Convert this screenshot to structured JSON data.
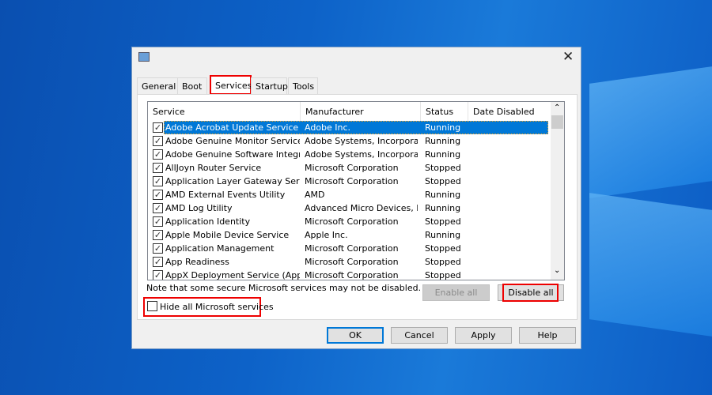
{
  "tabs": [
    "General",
    "Boot",
    "Services",
    "Startup",
    "Tools"
  ],
  "active_tab": "Services",
  "columns": [
    "Service",
    "Manufacturer",
    "Status",
    "Date Disabled"
  ],
  "rows": [
    {
      "service": "Adobe Acrobat Update Service",
      "manufacturer": "Adobe Inc.",
      "status": "Running",
      "checked": true,
      "selected": true
    },
    {
      "service": "Adobe Genuine Monitor Service",
      "manufacturer": "Adobe Systems, Incorpora...",
      "status": "Running",
      "checked": true
    },
    {
      "service": "Adobe Genuine Software Integri...",
      "manufacturer": "Adobe Systems, Incorpora...",
      "status": "Running",
      "checked": true
    },
    {
      "service": "AllJoyn Router Service",
      "manufacturer": "Microsoft Corporation",
      "status": "Stopped",
      "checked": true
    },
    {
      "service": "Application Layer Gateway Service",
      "manufacturer": "Microsoft Corporation",
      "status": "Stopped",
      "checked": true
    },
    {
      "service": "AMD External Events Utility",
      "manufacturer": "AMD",
      "status": "Running",
      "checked": true
    },
    {
      "service": "AMD Log Utility",
      "manufacturer": "Advanced Micro Devices, I...",
      "status": "Running",
      "checked": true
    },
    {
      "service": "Application Identity",
      "manufacturer": "Microsoft Corporation",
      "status": "Stopped",
      "checked": true
    },
    {
      "service": "Apple Mobile Device Service",
      "manufacturer": "Apple Inc.",
      "status": "Running",
      "checked": true
    },
    {
      "service": "Application Management",
      "manufacturer": "Microsoft Corporation",
      "status": "Stopped",
      "checked": true
    },
    {
      "service": "App Readiness",
      "manufacturer": "Microsoft Corporation",
      "status": "Stopped",
      "checked": true
    },
    {
      "service": "AppX Deployment Service (AppX...",
      "manufacturer": "Microsoft Corporation",
      "status": "Stopped",
      "checked": true
    }
  ],
  "note": "Note that some secure Microsoft services may not be disabled.",
  "enable_all": "Enable all",
  "disable_all": "Disable all",
  "hide_ms": "Hide all Microsoft services",
  "hide_ms_checked": false,
  "ok": "OK",
  "cancel": "Cancel",
  "apply": "Apply",
  "help": "Help",
  "highlight_color": "#e00000",
  "selection_color": "#0078d7"
}
